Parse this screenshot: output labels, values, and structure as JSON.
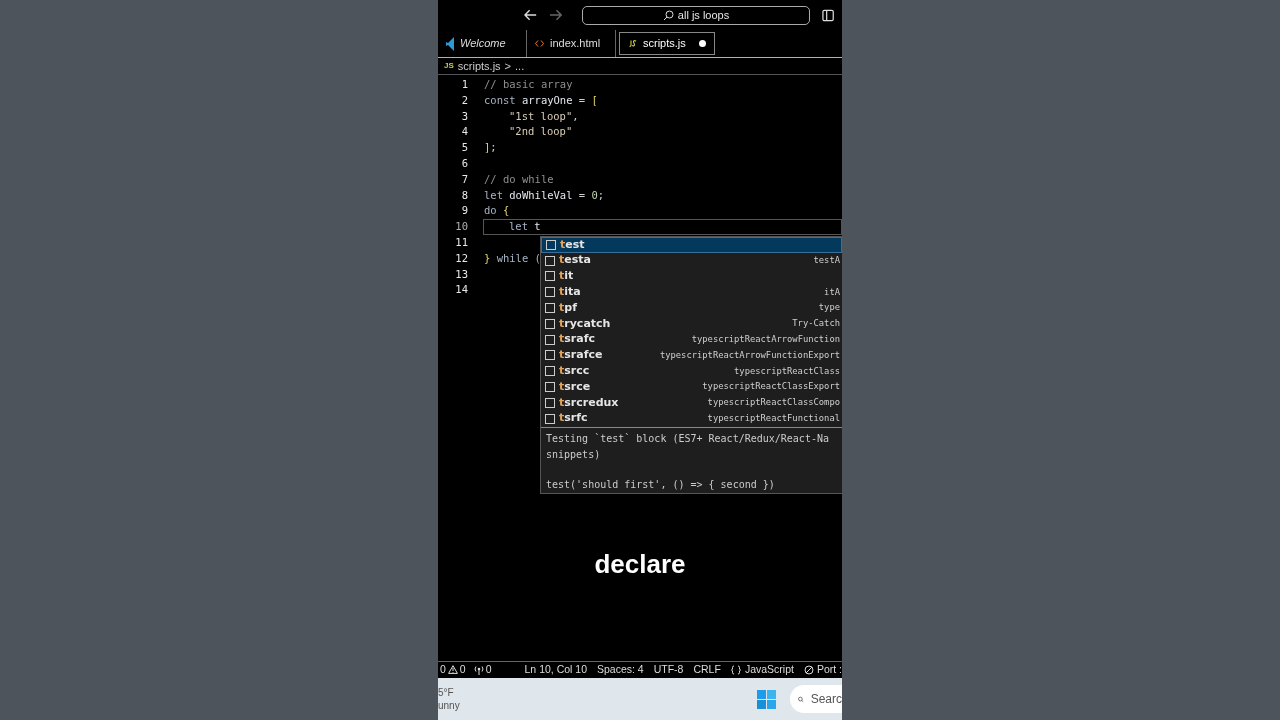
{
  "title_bar": {
    "search": "all js loops"
  },
  "tabs": [
    {
      "label": "Welcome",
      "selected": false,
      "modified": false
    },
    {
      "label": "index.html",
      "selected": false,
      "modified": false
    },
    {
      "label": "scripts.js",
      "selected": true,
      "modified": true
    }
  ],
  "breadcrumb": {
    "icon": "JS",
    "file": "scripts.js",
    "sep": ">",
    "rest": "..."
  },
  "code_lines": [
    {
      "number": "1",
      "current": false,
      "tokens": [
        {
          "text": "// basic array",
          "kind": "comment"
        }
      ]
    },
    {
      "number": "2",
      "current": false,
      "tokens": [
        {
          "text": "const ",
          "kind": "keyword"
        },
        {
          "text": "arrayOne",
          "kind": "ident"
        },
        {
          "text": " = ",
          "kind": "plain"
        },
        {
          "text": "[",
          "kind": "bracket"
        }
      ]
    },
    {
      "number": "3",
      "current": false,
      "indented": true,
      "tokens": [
        {
          "text": "\"1st loop\"",
          "kind": "string"
        },
        {
          "text": ",",
          "kind": "plain"
        }
      ]
    },
    {
      "number": "4",
      "current": false,
      "indented": true,
      "tokens": [
        {
          "text": "\"2nd loop\"",
          "kind": "string"
        }
      ]
    },
    {
      "number": "5",
      "current": false,
      "tokens": [
        {
          "text": "]",
          "kind": "bracket"
        },
        {
          "text": ";",
          "kind": "plain"
        }
      ]
    },
    {
      "number": "6",
      "current": false
    },
    {
      "number": "7",
      "current": false,
      "tokens": [
        {
          "text": "// do while",
          "kind": "comment"
        }
      ]
    },
    {
      "number": "8",
      "current": false,
      "tokens": [
        {
          "text": "let ",
          "kind": "keyword"
        },
        {
          "text": "doWhileVal",
          "kind": "ident"
        },
        {
          "text": " = ",
          "kind": "plain"
        },
        {
          "text": "0",
          "kind": "number"
        },
        {
          "text": ";",
          "kind": "plain"
        }
      ]
    },
    {
      "number": "9",
      "current": false,
      "tokens": [
        {
          "text": "do ",
          "kind": "keyword"
        },
        {
          "text": "{",
          "kind": "bracket"
        }
      ]
    },
    {
      "number": "10",
      "current": true,
      "indented": true,
      "tokens": [
        {
          "text": "let ",
          "kind": "keyword"
        },
        {
          "text": "t",
          "kind": "ident"
        }
      ]
    },
    {
      "number": "11",
      "current": false
    },
    {
      "number": "12",
      "current": false,
      "tokens": [
        {
          "text": "}",
          "kind": "bracket"
        },
        {
          "text": " while (",
          "kind": "keyword"
        }
      ]
    },
    {
      "number": "13",
      "current": false
    },
    {
      "number": "14",
      "current": false
    }
  ],
  "suggestions": [
    {
      "match": "t",
      "rest": "est",
      "selected": true
    },
    {
      "match": "t",
      "rest": "esta",
      "detail": "testA",
      "selected": false
    },
    {
      "match": "t",
      "rest": "it",
      "selected": false
    },
    {
      "match": "t",
      "rest": "ita",
      "detail": "itA",
      "selected": false
    },
    {
      "match": "t",
      "rest": "pf",
      "detail": "type",
      "selected": false
    },
    {
      "match": "t",
      "rest": "rycatch",
      "detail": "Try-Catch",
      "selected": false
    },
    {
      "match": "t",
      "rest": "srafc",
      "detail": "typescriptReactArrowFunction",
      "selected": false
    },
    {
      "match": "t",
      "rest": "srafce",
      "detail": "typescriptReactArrowFunctionExport",
      "selected": false
    },
    {
      "match": "t",
      "rest": "srcc",
      "detail": "typescriptReactClass",
      "selected": false
    },
    {
      "match": "t",
      "rest": "srce",
      "detail": "typescriptReactClassExport",
      "selected": false
    },
    {
      "match": "t",
      "rest": "srcredux",
      "detail": "typescriptReactClassCompo",
      "selected": false
    },
    {
      "match": "t",
      "rest": "srfc",
      "detail": "typescriptReactFunctional",
      "selected": false
    }
  ],
  "suggestion_doc": {
    "lines": [
      "Testing `test` block (ES7+ React/Redux/React-Na",
      "snippets)"
    ],
    "example": "test('should first', () => { second })"
  },
  "caption": "declare",
  "status_bar": {
    "left": [
      {
        "kind": "errors",
        "text": "0"
      },
      {
        "kind": "warnings",
        "text": "0"
      },
      {
        "kind": "ports",
        "text": "0"
      }
    ],
    "right": [
      {
        "kind": "text",
        "text": "Ln 10, Col 10"
      },
      {
        "kind": "text",
        "text": "Spaces: 4"
      },
      {
        "kind": "text",
        "text": "UTF-8"
      },
      {
        "kind": "text",
        "text": "CRLF"
      },
      {
        "kind": "language",
        "text": "JavaScript"
      },
      {
        "kind": "port",
        "text": "Port :"
      }
    ]
  },
  "taskbar": {
    "weather": [
      "5°F",
      "unny"
    ],
    "search": "Searc"
  }
}
